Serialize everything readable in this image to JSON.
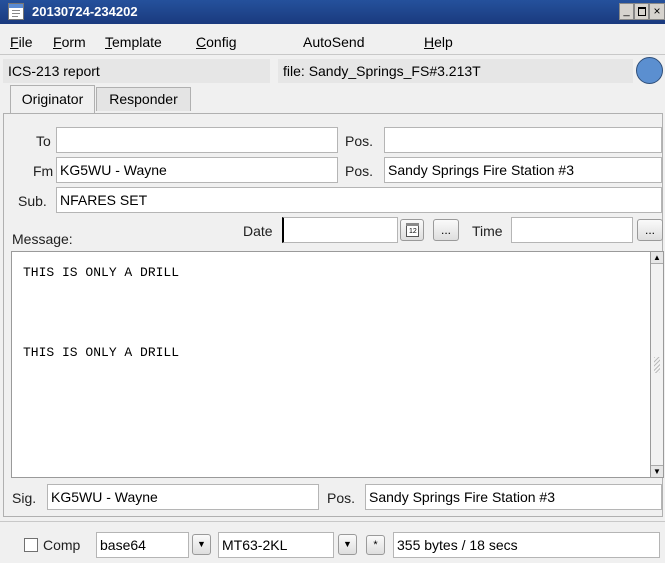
{
  "window": {
    "title": "20130724-234202"
  },
  "menu": [
    "File",
    "Form",
    "Template",
    "Config",
    "AutoSend",
    "Help"
  ],
  "info": {
    "report_type": "ICS-213 report",
    "file_label": "file:",
    "file_name": "Sandy_Springs_FS#3.213T"
  },
  "tabs": [
    "Originator",
    "Responder"
  ],
  "form": {
    "to_label": "To",
    "to_value": "",
    "to_pos_label": "Pos.",
    "to_pos_value": "",
    "fm_label": "Fm",
    "fm_value": "KG5WU - Wayne",
    "fm_pos_label": "Pos.",
    "fm_pos_value": "Sandy Springs Fire Station #3",
    "sub_label": "Sub.",
    "sub_value": "NFARES SET",
    "message_label": "Message:",
    "date_label": "Date",
    "date_value": "",
    "time_label": "Time",
    "time_value": "",
    "ellipsis": "...",
    "message_lines": [
      "THIS IS ONLY A DRILL",
      "THIS IS ONLY A DRILL"
    ],
    "sig_label": "Sig.",
    "sig_value": "KG5WU - Wayne",
    "sig_pos_label": "Pos.",
    "sig_pos_value": "Sandy Springs Fire Station #3"
  },
  "footer": {
    "comp_label": "Comp",
    "comp_checked": false,
    "encoding": "base64",
    "mode": "MT63-2KL",
    "star": "*",
    "status": "355 bytes / 18 secs"
  },
  "colors": {
    "titlebar": "#1c3f86",
    "status_circle": "#5b8fd0"
  }
}
